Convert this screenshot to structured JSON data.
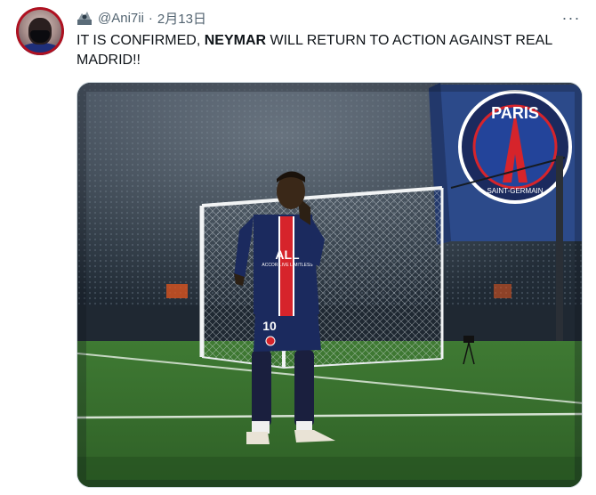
{
  "tweet": {
    "handle": "@Ani7ii",
    "separator": "·",
    "date": "2月13日",
    "more_label": "···",
    "text_part1": "IT IS CONFIRMED, ",
    "text_bold": "NEYMAR",
    "text_part2": " WILL RETURN TO ACTION AGAINST REAL MADRID!!"
  },
  "media": {
    "shirt_number": "10",
    "sponsor": "ALL",
    "sponsor_sub": "ACCOR LIVE LIMITLESS",
    "flag_text": "PARIS",
    "flag_subtext": "SAINT-GERMAIN"
  },
  "colors": {
    "psg_navy": "#1b2a5e",
    "psg_red": "#d6242b",
    "pitch_green": "#3f7a33",
    "text_secondary": "#536471"
  }
}
